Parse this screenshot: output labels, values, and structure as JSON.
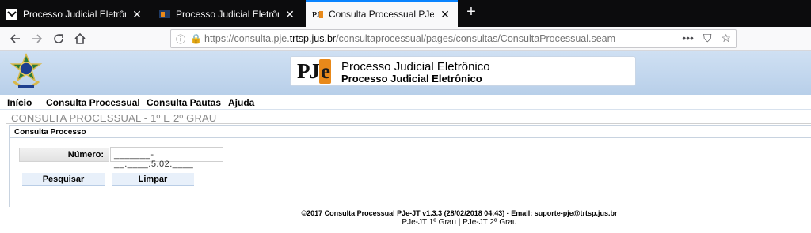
{
  "browser": {
    "tabs": [
      {
        "title": "Processo Judicial Eletrônico - T",
        "active": false
      },
      {
        "title": "Processo Judicial Eletrônico: [c",
        "active": false
      },
      {
        "title": "Consulta Processual PJe-JT",
        "active": true
      }
    ],
    "url": {
      "prefix": "https://consulta.pje.",
      "host": "trtsp.jus.br",
      "path": "/consultaprocessual/pages/consultas/ConsultaProcessual.seam"
    },
    "overflow_icon": "•••"
  },
  "banner": {
    "logo_text": "PJ",
    "logo_letter": "e",
    "title_line1": "Processo Judicial Eletrônico",
    "title_line2": "Processo Judicial Eletrônico"
  },
  "menu": {
    "items": [
      "Início",
      "Consulta Processual",
      "Consulta Pautas",
      "Ajuda"
    ]
  },
  "page": {
    "header": "CONSULTA PROCESSUAL - 1º E 2º GRAU",
    "panel_title": "Consulta Processo",
    "field_label": "Número:",
    "field_value": "_______-__.____.5.02.____",
    "search_button": "Pesquisar",
    "clear_button": "Limpar"
  },
  "footer": {
    "line1": "©2017 Consulta Processual PJe-JT v1.3.3 (28/02/2018 04:43) - Email: suporte-pje@trtsp.jus.br",
    "line2": "PJe-JT 1º Grau | PJe-JT 2º Grau"
  }
}
